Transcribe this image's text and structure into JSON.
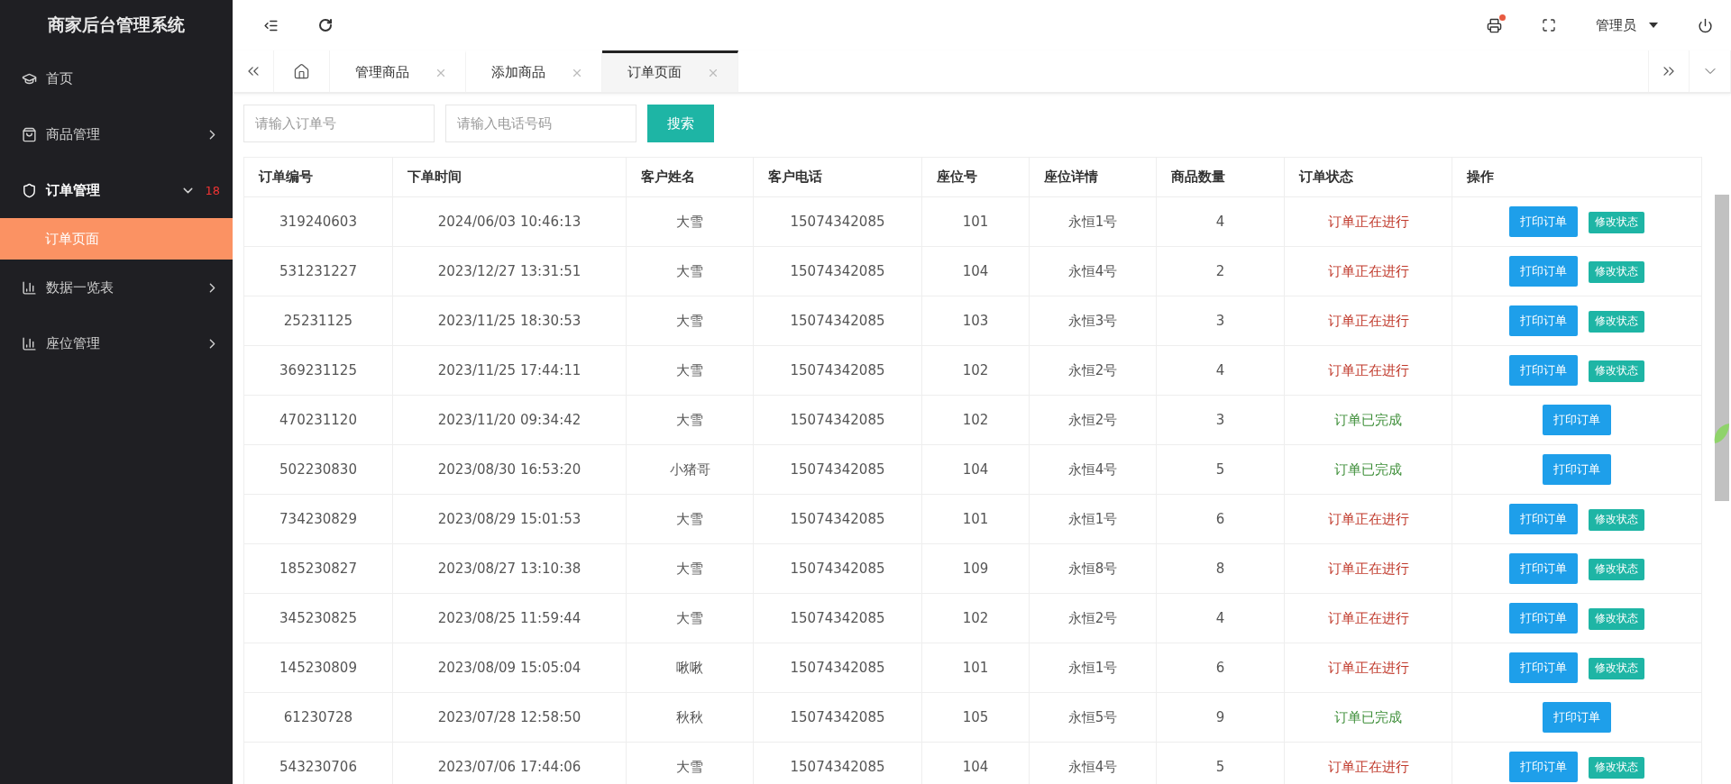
{
  "sidebar": {
    "title": "商家后台管理系统",
    "items": [
      {
        "label": "首页",
        "expanded": false
      },
      {
        "label": "商品管理",
        "expanded": false
      },
      {
        "label": "订单管理",
        "expanded": true,
        "badge": "18",
        "children": [
          {
            "label": "订单页面",
            "selected": true
          }
        ]
      },
      {
        "label": "数据一览表",
        "expanded": false
      },
      {
        "label": "座位管理",
        "expanded": false
      }
    ]
  },
  "header": {
    "notification": true,
    "user": "管理员"
  },
  "tabs": [
    {
      "label": "管理商品",
      "selected": false
    },
    {
      "label": "添加商品",
      "selected": false
    },
    {
      "label": "订单页面",
      "selected": true
    }
  ],
  "search": {
    "order_placeholder": "请输入订单号",
    "phone_placeholder": "请输入电话号码",
    "button": "搜索"
  },
  "table": {
    "columns": [
      "订单编号",
      "下单时间",
      "客户姓名",
      "客户电话",
      "座位号",
      "座位详情",
      "商品数量",
      "订单状态",
      "操作"
    ],
    "rows": [
      {
        "cells": [
          "319240603",
          "2024/06/03 10:46:13",
          "大雪",
          "15074342085",
          "101",
          "永恒1号",
          "4"
        ],
        "status": {
          "text": "订单正在进行",
          "kind": "progress"
        },
        "actions": [
          {
            "label": "打印订单",
            "kind": "print"
          },
          {
            "label": "修改状态",
            "kind": "modify"
          }
        ]
      },
      {
        "cells": [
          "531231227",
          "2023/12/27 13:31:51",
          "大雪",
          "15074342085",
          "104",
          "永恒4号",
          "2"
        ],
        "status": {
          "text": "订单正在进行",
          "kind": "progress"
        },
        "actions": [
          {
            "label": "打印订单",
            "kind": "print"
          },
          {
            "label": "修改状态",
            "kind": "modify"
          }
        ]
      },
      {
        "cells": [
          "25231125",
          "2023/11/25 18:30:53",
          "大雪",
          "15074342085",
          "103",
          "永恒3号",
          "3"
        ],
        "status": {
          "text": "订单正在进行",
          "kind": "progress"
        },
        "actions": [
          {
            "label": "打印订单",
            "kind": "print"
          },
          {
            "label": "修改状态",
            "kind": "modify"
          }
        ]
      },
      {
        "cells": [
          "369231125",
          "2023/11/25 17:44:11",
          "大雪",
          "15074342085",
          "102",
          "永恒2号",
          "4"
        ],
        "status": {
          "text": "订单正在进行",
          "kind": "progress"
        },
        "actions": [
          {
            "label": "打印订单",
            "kind": "print"
          },
          {
            "label": "修改状态",
            "kind": "modify"
          }
        ]
      },
      {
        "cells": [
          "470231120",
          "2023/11/20 09:34:42",
          "大雪",
          "15074342085",
          "102",
          "永恒2号",
          "3"
        ],
        "status": {
          "text": "订单已完成",
          "kind": "done"
        },
        "actions": [
          {
            "label": "打印订单",
            "kind": "print"
          }
        ]
      },
      {
        "cells": [
          "502230830",
          "2023/08/30 16:53:20",
          "小猪哥",
          "15074342085",
          "104",
          "永恒4号",
          "5"
        ],
        "status": {
          "text": "订单已完成",
          "kind": "done"
        },
        "actions": [
          {
            "label": "打印订单",
            "kind": "print"
          }
        ]
      },
      {
        "cells": [
          "734230829",
          "2023/08/29 15:01:53",
          "大雪",
          "15074342085",
          "101",
          "永恒1号",
          "6"
        ],
        "status": {
          "text": "订单正在进行",
          "kind": "progress"
        },
        "actions": [
          {
            "label": "打印订单",
            "kind": "print"
          },
          {
            "label": "修改状态",
            "kind": "modify"
          }
        ]
      },
      {
        "cells": [
          "185230827",
          "2023/08/27 13:10:38",
          "大雪",
          "15074342085",
          "109",
          "永恒8号",
          "8"
        ],
        "status": {
          "text": "订单正在进行",
          "kind": "progress"
        },
        "actions": [
          {
            "label": "打印订单",
            "kind": "print"
          },
          {
            "label": "修改状态",
            "kind": "modify"
          }
        ]
      },
      {
        "cells": [
          "345230825",
          "2023/08/25 11:59:44",
          "大雪",
          "15074342085",
          "102",
          "永恒2号",
          "4"
        ],
        "status": {
          "text": "订单正在进行",
          "kind": "progress"
        },
        "actions": [
          {
            "label": "打印订单",
            "kind": "print"
          },
          {
            "label": "修改状态",
            "kind": "modify"
          }
        ]
      },
      {
        "cells": [
          "145230809",
          "2023/08/09 15:05:04",
          "啾啾",
          "15074342085",
          "101",
          "永恒1号",
          "6"
        ],
        "status": {
          "text": "订单正在进行",
          "kind": "progress"
        },
        "actions": [
          {
            "label": "打印订单",
            "kind": "print"
          },
          {
            "label": "修改状态",
            "kind": "modify"
          }
        ]
      },
      {
        "cells": [
          "61230728",
          "2023/07/28 12:58:50",
          "秋秋",
          "15074342085",
          "105",
          "永恒5号",
          "9"
        ],
        "status": {
          "text": "订单已完成",
          "kind": "done"
        },
        "actions": [
          {
            "label": "打印订单",
            "kind": "print"
          }
        ]
      },
      {
        "cells": [
          "543230706",
          "2023/07/06 17:44:06",
          "大雪",
          "15074342085",
          "104",
          "永恒4号",
          "5"
        ],
        "status": {
          "text": "订单正在进行",
          "kind": "progress"
        },
        "actions": [
          {
            "label": "打印订单",
            "kind": "print"
          },
          {
            "label": "修改状态",
            "kind": "modify"
          }
        ]
      }
    ]
  }
}
